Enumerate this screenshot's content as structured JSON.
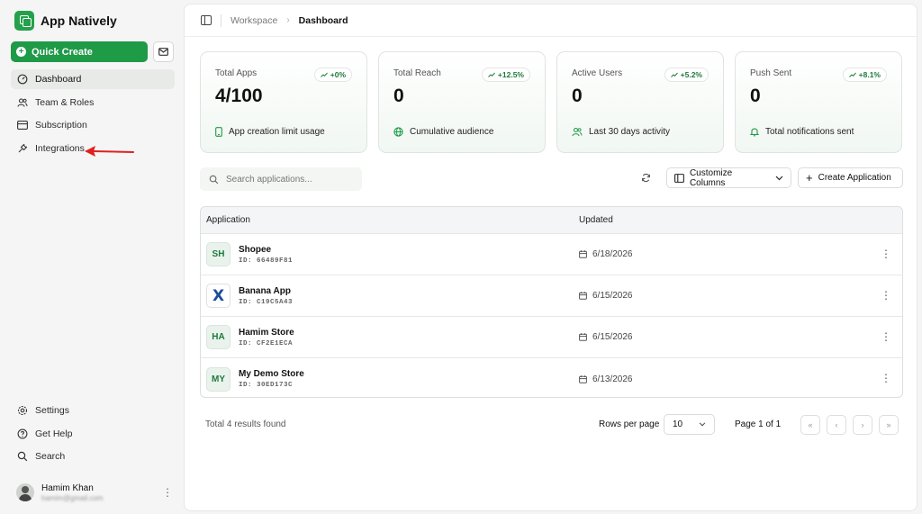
{
  "brand": {
    "name": "App Natively"
  },
  "sidebar": {
    "quick_create": "Quick Create",
    "items": [
      {
        "label": "Dashboard",
        "icon": "gauge-icon",
        "active": true
      },
      {
        "label": "Team & Roles",
        "icon": "users-icon"
      },
      {
        "label": "Subscription",
        "icon": "card-icon"
      },
      {
        "label": "Integrations",
        "icon": "plug-icon"
      }
    ],
    "bottom_items": [
      {
        "label": "Settings",
        "icon": "gear-icon"
      },
      {
        "label": "Get Help",
        "icon": "help-icon"
      },
      {
        "label": "Search",
        "icon": "search-icon"
      }
    ],
    "user": {
      "name": "Hamim Khan",
      "email": "hamim@gmail.com"
    }
  },
  "breadcrumb": {
    "root": "Workspace",
    "current": "Dashboard"
  },
  "cards": [
    {
      "label": "Total Apps",
      "badge": "+0%",
      "value": "4/100",
      "footer": "App creation limit usage",
      "icon": "phone-icon"
    },
    {
      "label": "Total Reach",
      "badge": "+12.5%",
      "value": "0",
      "footer": "Cumulative audience",
      "icon": "globe-icon"
    },
    {
      "label": "Active Users",
      "badge": "+5.2%",
      "value": "0",
      "footer": "Last 30 days activity",
      "icon": "users-icon"
    },
    {
      "label": "Push Sent",
      "badge": "+8.1%",
      "value": "0",
      "footer": "Total notifications sent",
      "icon": "bell-icon"
    }
  ],
  "toolbar": {
    "search_placeholder": "Search applications...",
    "customize": "Customize Columns",
    "create": "Create Application"
  },
  "table": {
    "headers": {
      "application": "Application",
      "updated": "Updated"
    },
    "rows": [
      {
        "initials": "SH",
        "name": "Shopee",
        "id": "ID: 66489F81",
        "date": "6/18/2026",
        "logo": false
      },
      {
        "initials": "X",
        "name": "Banana App",
        "id": "ID: C19C5A43",
        "date": "6/15/2026",
        "logo": true
      },
      {
        "initials": "HA",
        "name": "Hamim Store",
        "id": "ID: CF2E1ECA",
        "date": "6/15/2026",
        "logo": false
      },
      {
        "initials": "MY",
        "name": "My Demo Store",
        "id": "ID: 30ED173C",
        "date": "6/13/2026",
        "logo": false
      }
    ]
  },
  "footer": {
    "total": "Total 4 results found",
    "rows_per_page_label": "Rows per page",
    "rows_per_page": "10",
    "page": "Page 1 of 1"
  },
  "colors": {
    "accent": "#1f9a47",
    "annotation_arrow": "#e02020"
  }
}
